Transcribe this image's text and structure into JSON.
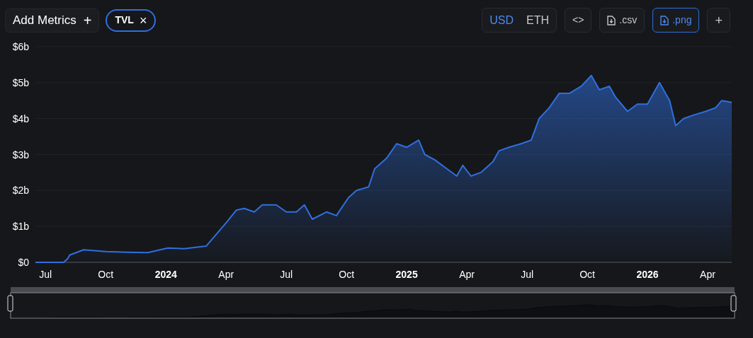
{
  "toolbar": {
    "add_metrics": {
      "label": "Add Metrics",
      "icon": "+"
    },
    "chips": [
      {
        "label": "TVL",
        "icon": "×"
      }
    ],
    "currencies": [
      {
        "label": "USD",
        "selected": true
      },
      {
        "label": "ETH",
        "selected": false
      }
    ],
    "actions": [
      {
        "kind": "embed",
        "label": "<>",
        "selected": false
      },
      {
        "kind": "download",
        "label": ".csv",
        "selected": false
      },
      {
        "kind": "download",
        "label": ".png",
        "selected": true
      },
      {
        "kind": "add",
        "label": "+",
        "selected": false
      }
    ]
  },
  "chart": {
    "chart_data": {
      "type": "area",
      "grid": true,
      "ylim": [
        0,
        6
      ],
      "xlim": [
        2023.458,
        2026.35
      ],
      "yticks": [
        {
          "value": 0,
          "label": "$0"
        },
        {
          "value": 1,
          "label": "$1b"
        },
        {
          "value": 2,
          "label": "$2b"
        },
        {
          "value": 3,
          "label": "$3b"
        },
        {
          "value": 4,
          "label": "$4b"
        },
        {
          "value": 5,
          "label": "$5b"
        },
        {
          "value": 6,
          "label": "$6b"
        }
      ],
      "xticks": [
        {
          "value": 2023.5,
          "label": "Jul"
        },
        {
          "value": 2023.75,
          "label": "Oct"
        },
        2024,
        {
          "value": 2024.25,
          "label": "Apr"
        },
        {
          "value": 2024.5,
          "label": "Jul"
        },
        {
          "value": 2024.75,
          "label": "Oct"
        },
        2025,
        {
          "value": 2025.25,
          "label": "Apr"
        },
        {
          "value": 2025.5,
          "label": "Jul"
        },
        {
          "value": 2025.75,
          "label": "Oct"
        },
        2026,
        {
          "value": 2026.25,
          "label": "Apr"
        }
      ],
      "x": [
        2023.458,
        2023.575,
        2023.592,
        2023.6,
        2023.658,
        2023.75,
        2023.842,
        2023.925,
        2024.008,
        2024.075,
        2024.167,
        2024.25,
        2024.292,
        2024.325,
        2024.367,
        2024.4,
        2024.458,
        2024.5,
        2024.542,
        2024.575,
        2024.608,
        2024.667,
        2024.708,
        2024.758,
        2024.792,
        2024.842,
        2024.867,
        2024.917,
        2024.958,
        2025.0,
        2025.05,
        2025.075,
        2025.117,
        2025.167,
        2025.208,
        2025.233,
        2025.267,
        2025.308,
        2025.358,
        2025.383,
        2025.425,
        2025.475,
        2025.517,
        2025.55,
        2025.592,
        2025.633,
        2025.675,
        2025.725,
        2025.767,
        2025.8,
        2025.842,
        2025.867,
        2025.917,
        2025.958,
        2026.0,
        2026.05,
        2026.092,
        2026.117,
        2026.15,
        2026.192,
        2026.242,
        2026.283,
        2026.308,
        2026.35
      ],
      "series": [
        {
          "color": "#2f6fde",
          "values": [
            0,
            0,
            0.1,
            0.2,
            0.35,
            0.3,
            0.28,
            0.27,
            0.4,
            0.38,
            0.45,
            1.1,
            1.45,
            1.5,
            1.4,
            1.6,
            1.6,
            1.4,
            1.4,
            1.6,
            1.2,
            1.4,
            1.3,
            1.8,
            2.0,
            2.1,
            2.6,
            2.9,
            3.3,
            3.2,
            3.4,
            3.0,
            2.85,
            2.6,
            2.4,
            2.7,
            2.4,
            2.5,
            2.8,
            3.1,
            3.2,
            3.3,
            3.4,
            4.0,
            4.3,
            4.7,
            4.7,
            4.9,
            5.2,
            4.8,
            4.9,
            4.6,
            4.2,
            4.4,
            4.4,
            5.0,
            4.5,
            3.8,
            4.0,
            4.1,
            4.2,
            4.3,
            4.5,
            4.45
          ]
        }
      ]
    }
  }
}
